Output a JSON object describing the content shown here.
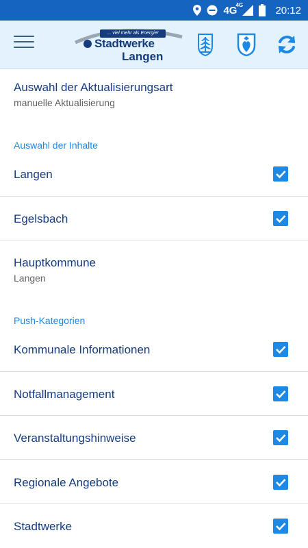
{
  "status_bar": {
    "network": "4G",
    "network_sup": "4G",
    "time": "20:12",
    "icons": [
      "location-icon",
      "do-not-disturb-icon",
      "signal-icon",
      "battery-icon"
    ]
  },
  "toolbar": {
    "logo_tagline": "... viel mehr als Energie!",
    "logo_name": "Stadtwerke",
    "logo_city": "Langen",
    "icons": [
      "menu-icon",
      "crest-langen-icon",
      "crest-egelsbach-icon",
      "refresh-icon"
    ]
  },
  "settings": {
    "update_type": {
      "title": "Auswahl der Aktualisierungsart",
      "value": "manuelle Aktualisierung"
    },
    "content_section": {
      "header": "Auswahl der Inhalte",
      "items": [
        {
          "label": "Langen",
          "checked": true
        },
        {
          "label": "Egelsbach",
          "checked": true
        }
      ]
    },
    "main_municipality": {
      "title": "Hauptkommune",
      "value": "Langen"
    },
    "push_section": {
      "header": "Push-Kategorien",
      "items": [
        {
          "label": "Kommunale Informationen",
          "checked": true
        },
        {
          "label": "Notfallmanagement",
          "checked": true
        },
        {
          "label": "Veranstaltungshinweise",
          "checked": true
        },
        {
          "label": "Regionale Angebote",
          "checked": true
        },
        {
          "label": "Stadtwerke",
          "checked": true
        }
      ]
    }
  },
  "colors": {
    "status_bar": "#1565c0",
    "toolbar": "#e3f2fd",
    "text_primary": "#173c7e",
    "accent": "#1e88e5"
  }
}
